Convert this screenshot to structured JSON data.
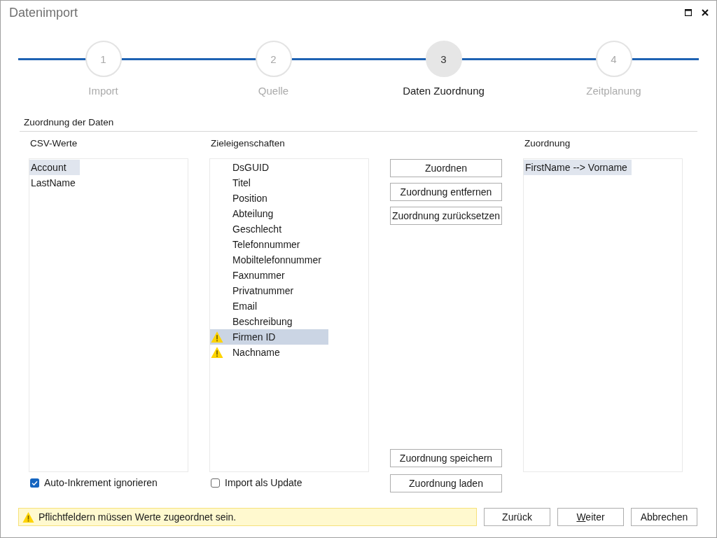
{
  "window": {
    "title": "Datenimport"
  },
  "steps": [
    {
      "number": "1",
      "label": "Import",
      "selected": false
    },
    {
      "number": "2",
      "label": "Quelle",
      "selected": false
    },
    {
      "number": "3",
      "label": "Daten Zuordnung",
      "selected": true
    },
    {
      "number": "4",
      "label": "Zeitplanung",
      "selected": false
    }
  ],
  "section": {
    "title": "Zuordnung der Daten"
  },
  "csv_values": {
    "heading": "CSV-Werte",
    "focused": false,
    "items": [
      {
        "label": "Account",
        "selected": true
      },
      {
        "label": "LastName",
        "selected": false
      }
    ]
  },
  "target_properties": {
    "heading": "Zieleigenschaften",
    "focused": true,
    "items": [
      {
        "label": "DsGUID",
        "selected": false,
        "warning": false
      },
      {
        "label": "Titel",
        "selected": false,
        "warning": false
      },
      {
        "label": "Position",
        "selected": false,
        "warning": false
      },
      {
        "label": "Abteilung",
        "selected": false,
        "warning": false
      },
      {
        "label": "Geschlecht",
        "selected": false,
        "warning": false
      },
      {
        "label": "Telefonnummer",
        "selected": false,
        "warning": false
      },
      {
        "label": "Mobiltelefonnummer",
        "selected": false,
        "warning": false
      },
      {
        "label": "Faxnummer",
        "selected": false,
        "warning": false
      },
      {
        "label": "Privatnummer",
        "selected": false,
        "warning": false
      },
      {
        "label": "Email",
        "selected": false,
        "warning": false
      },
      {
        "label": "Beschreibung",
        "selected": false,
        "warning": false
      },
      {
        "label": "Firmen ID",
        "selected": true,
        "warning": true
      },
      {
        "label": "Nachname",
        "selected": false,
        "warning": true
      }
    ]
  },
  "mapping_actions": [
    "Zuordnen",
    "Zuordnung entfernen",
    "Zuordnung zurücksetzen"
  ],
  "mapping_file_actions": [
    "Zuordnung speichern",
    "Zuordnung laden"
  ],
  "mappings": {
    "heading": "Zuordnung",
    "focused": false,
    "items": [
      {
        "label": "FirstName --> Vorname",
        "selected": true
      }
    ]
  },
  "options": [
    {
      "label": "Auto-Inkrement ignorieren",
      "checked": true
    },
    {
      "label": "Import als Update",
      "checked": false
    }
  ],
  "status_bar": {
    "message": "Pflichtfeldern müssen Werte zugeordnet sein."
  },
  "buttons": [
    {
      "label": "Zurück",
      "access_key": false
    },
    {
      "label": "Weiter",
      "access_key": true
    },
    {
      "label": "Abbrechen",
      "access_key": false
    }
  ]
}
